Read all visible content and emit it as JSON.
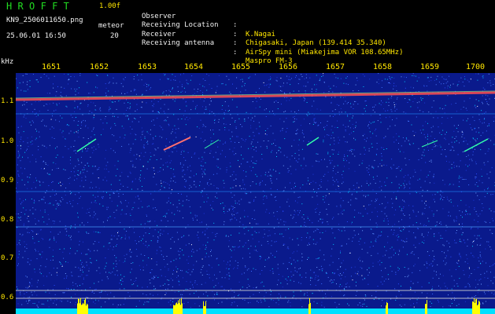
{
  "header": {
    "app_title": "HROFFT",
    "version": "1.00f",
    "file_name": "KN9_2506011650.png",
    "capture_time": "25.06.01 16:50",
    "mode_label": "meteor",
    "mode_value": "20"
  },
  "info": [
    {
      "label": "Observer",
      "sep": ":",
      "value": "K.Nagai"
    },
    {
      "label": "Receiving Location",
      "sep": ":",
      "value": "Chigasaki, Japan (139.414 35.340)"
    },
    {
      "label": "Receiver",
      "sep": ":",
      "value": "AirSpy mini (Miakejima VOR 108.65MHz)"
    },
    {
      "label": "Receiving antenna",
      "sep": ":",
      "value": "Maspro FM-3"
    }
  ],
  "axis": {
    "unit": "kHz",
    "time_ticks": [
      "1651",
      "1652",
      "1653",
      "1654",
      "1655",
      "1656",
      "1657",
      "1658",
      "1659",
      "1700"
    ],
    "freq_ticks": [
      "1.1",
      "1.0",
      "0.9",
      "0.8",
      "0.7",
      "0.6"
    ]
  },
  "colors": {
    "background": "#000000",
    "header_green": "#22dd22",
    "header_yellow": "#ffe600",
    "tick_yellow": "#ffe600",
    "noise_base": "#0a1a8c",
    "carrier": "#ff5050",
    "baseline": "#00e0ff",
    "bursts": "#ffff00"
  }
}
